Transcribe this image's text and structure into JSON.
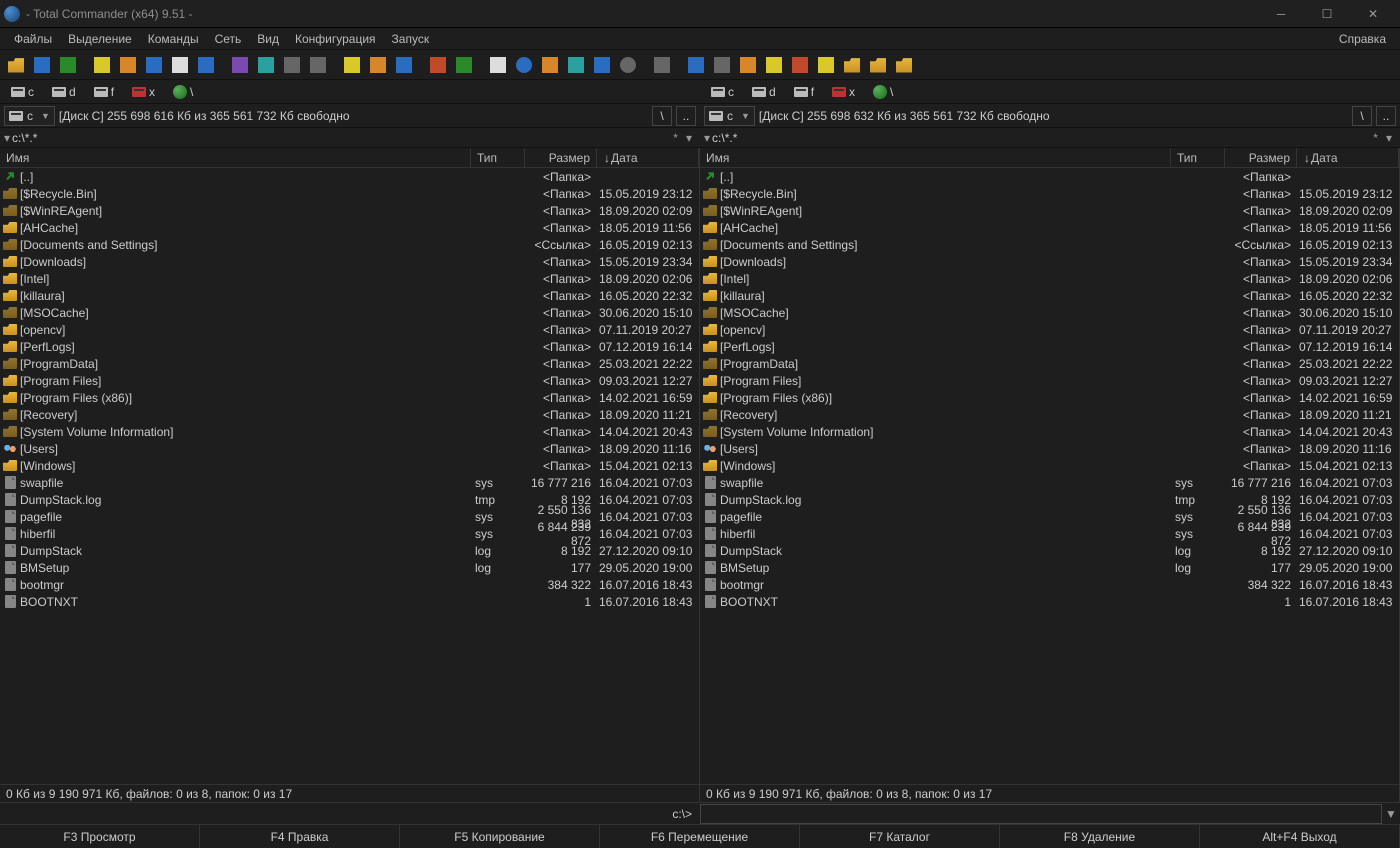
{
  "window": {
    "title": " - Total Commander (x64) 9.51 - "
  },
  "menu": {
    "items": [
      "Файлы",
      "Выделение",
      "Команды",
      "Сеть",
      "Вид",
      "Конфигурация",
      "Запуск"
    ],
    "right": "Справка"
  },
  "toolbar": {
    "buttons": [
      {
        "name": "open-icon",
        "cls": "ic-open"
      },
      {
        "name": "split-icon",
        "cls": "ic-blue"
      },
      {
        "name": "refresh-icon",
        "cls": "ic-green"
      },
      {
        "name": "sep"
      },
      {
        "name": "windows-icon",
        "cls": "ic-yellow"
      },
      {
        "name": "desktop-icon",
        "cls": "ic-orange"
      },
      {
        "name": "screen-icon",
        "cls": "ic-blue"
      },
      {
        "name": "doc-icon",
        "cls": "ic-white"
      },
      {
        "name": "grid-icon",
        "cls": "ic-blue"
      },
      {
        "name": "sep"
      },
      {
        "name": "paint-icon",
        "cls": "ic-purple"
      },
      {
        "name": "tool-1-icon",
        "cls": "ic-teal"
      },
      {
        "name": "tool-2-icon",
        "cls": "ic-gray"
      },
      {
        "name": "cmd-icon",
        "cls": "ic-gray"
      },
      {
        "name": "sep"
      },
      {
        "name": "gear-icon",
        "cls": "ic-yellow"
      },
      {
        "name": "box-icon",
        "cls": "ic-orange"
      },
      {
        "name": "people-icon",
        "cls": "ic-blue"
      },
      {
        "name": "sep"
      },
      {
        "name": "disk-icon",
        "cls": "ic-red"
      },
      {
        "name": "image-icon",
        "cls": "ic-green"
      },
      {
        "name": "sep"
      },
      {
        "name": "note-icon",
        "cls": "ic-white"
      },
      {
        "name": "go-icon",
        "cls": "ic-blue ic-circ"
      },
      {
        "name": "target-icon",
        "cls": "ic-orange"
      },
      {
        "name": "flag-icon",
        "cls": "ic-teal"
      },
      {
        "name": "window-icon",
        "cls": "ic-blue"
      },
      {
        "name": "cd-icon",
        "cls": "ic-gray ic-circ"
      },
      {
        "name": "sep"
      },
      {
        "name": "bug-icon",
        "cls": "ic-gray"
      },
      {
        "name": "sep"
      },
      {
        "name": "monitor-icon",
        "cls": "ic-blue"
      },
      {
        "name": "trash-icon",
        "cls": "ic-gray"
      },
      {
        "name": "pack-icon",
        "cls": "ic-orange"
      },
      {
        "name": "lock-icon",
        "cls": "ic-yellow"
      },
      {
        "name": "x-icon",
        "cls": "ic-red"
      },
      {
        "name": "star-icon",
        "cls": "ic-yellow"
      },
      {
        "name": "folder1-icon",
        "cls": "ic-open"
      },
      {
        "name": "folder2-icon",
        "cls": "ic-open"
      },
      {
        "name": "folder3-icon",
        "cls": "ic-open"
      }
    ]
  },
  "drives": {
    "items": [
      {
        "label": "c",
        "type": "hdd"
      },
      {
        "label": "d",
        "type": "hdd"
      },
      {
        "label": "f",
        "type": "hdd"
      },
      {
        "label": "x",
        "type": "net"
      },
      {
        "label": "\\",
        "type": "globe"
      }
    ]
  },
  "left": {
    "drive_label": "c",
    "disk_info": "[Диск C]  255 698 616 Кб из 365 561 732 Кб свободно",
    "nav_buttons": {
      "back": "\\",
      "up": ".."
    },
    "path": "c:\\*.*",
    "header": {
      "name": "Имя",
      "ext": "Тип",
      "size": "Размер",
      "date": "Дата",
      "sort_indicator": "↓"
    },
    "files": [
      {
        "icon": "up",
        "name": "[..]",
        "ext": "",
        "size": "<Папка>",
        "date": ""
      },
      {
        "icon": "folder",
        "hidden": true,
        "name": "[$Recycle.Bin]",
        "ext": "",
        "size": "<Папка>",
        "date": "15.05.2019 23:12"
      },
      {
        "icon": "folder",
        "hidden": true,
        "name": "[$WinREAgent]",
        "ext": "",
        "size": "<Папка>",
        "date": "18.09.2020 02:09"
      },
      {
        "icon": "folder",
        "name": "[AHCache]",
        "ext": "",
        "size": "<Папка>",
        "date": "18.05.2019 11:56"
      },
      {
        "icon": "folder",
        "hidden": true,
        "name": "[Documents and Settings]",
        "ext": "",
        "size": "<Ссылка>",
        "date": "16.05.2019 02:13"
      },
      {
        "icon": "folder",
        "name": "[Downloads]",
        "ext": "",
        "size": "<Папка>",
        "date": "15.05.2019 23:34"
      },
      {
        "icon": "folder",
        "name": "[Intel]",
        "ext": "",
        "size": "<Папка>",
        "date": "18.09.2020 02:06"
      },
      {
        "icon": "folder",
        "name": "[killaura]",
        "ext": "",
        "size": "<Папка>",
        "date": "16.05.2020 22:32"
      },
      {
        "icon": "folder",
        "hidden": true,
        "name": "[MSOCache]",
        "ext": "",
        "size": "<Папка>",
        "date": "30.06.2020 15:10"
      },
      {
        "icon": "folder",
        "name": "[opencv]",
        "ext": "",
        "size": "<Папка>",
        "date": "07.11.2019 20:27"
      },
      {
        "icon": "folder",
        "name": "[PerfLogs]",
        "ext": "",
        "size": "<Папка>",
        "date": "07.12.2019 16:14"
      },
      {
        "icon": "folder",
        "hidden": true,
        "name": "[ProgramData]",
        "ext": "",
        "size": "<Папка>",
        "date": "25.03.2021 22:22"
      },
      {
        "icon": "folder",
        "name": "[Program Files]",
        "ext": "",
        "size": "<Папка>",
        "date": "09.03.2021 12:27"
      },
      {
        "icon": "folder",
        "name": "[Program Files (x86)]",
        "ext": "",
        "size": "<Папка>",
        "date": "14.02.2021 16:59"
      },
      {
        "icon": "folder",
        "hidden": true,
        "name": "[Recovery]",
        "ext": "",
        "size": "<Папка>",
        "date": "18.09.2020 11:21"
      },
      {
        "icon": "folder",
        "hidden": true,
        "name": "[System Volume Information]",
        "ext": "",
        "size": "<Папка>",
        "date": "14.04.2021 20:43"
      },
      {
        "icon": "users",
        "name": "[Users]",
        "ext": "",
        "size": "<Папка>",
        "date": "18.09.2020 11:16"
      },
      {
        "icon": "folder",
        "name": "[Windows]",
        "ext": "",
        "size": "<Папка>",
        "date": "15.04.2021 02:13"
      },
      {
        "icon": "file",
        "hidden": true,
        "name": "swapfile",
        "ext": "sys",
        "size": "16 777 216",
        "date": "16.04.2021 07:03"
      },
      {
        "icon": "file",
        "hidden": true,
        "name": "DumpStack.log",
        "ext": "tmp",
        "size": "8 192",
        "date": "16.04.2021 07:03"
      },
      {
        "icon": "file",
        "hidden": true,
        "name": "pagefile",
        "ext": "sys",
        "size": "2 550 136 832",
        "date": "16.04.2021 07:03"
      },
      {
        "icon": "file",
        "hidden": true,
        "name": "hiberfil",
        "ext": "sys",
        "size": "6 844 239 872",
        "date": "16.04.2021 07:03"
      },
      {
        "icon": "file",
        "hidden": true,
        "name": "DumpStack",
        "ext": "log",
        "size": "8 192",
        "date": "27.12.2020 09:10"
      },
      {
        "icon": "file",
        "hidden": true,
        "name": "BMSetup",
        "ext": "log",
        "size": "177",
        "date": "29.05.2020 19:00"
      },
      {
        "icon": "file",
        "hidden": true,
        "name": "bootmgr",
        "ext": "",
        "size": "384 322",
        "date": "16.07.2016 18:43"
      },
      {
        "icon": "file",
        "hidden": true,
        "name": "BOOTNXT",
        "ext": "",
        "size": "1",
        "date": "16.07.2016 18:43"
      }
    ],
    "status": "0 Кб из 9 190 971 Кб, файлов: 0 из 8, папок: 0 из 17"
  },
  "right": {
    "drive_label": "c",
    "disk_info": "[Диск C]  255 698 632 Кб из 365 561 732 Кб свободно",
    "nav_buttons": {
      "back": "\\",
      "up": ".."
    },
    "path": "c:\\*.*",
    "header": {
      "name": "Имя",
      "ext": "Тип",
      "size": "Размер",
      "date": "Дата",
      "sort_indicator": "↓"
    },
    "files": [
      {
        "icon": "up",
        "name": "[..]",
        "ext": "",
        "size": "<Папка>",
        "date": ""
      },
      {
        "icon": "folder",
        "hidden": true,
        "name": "[$Recycle.Bin]",
        "ext": "",
        "size": "<Папка>",
        "date": "15.05.2019 23:12"
      },
      {
        "icon": "folder",
        "hidden": true,
        "name": "[$WinREAgent]",
        "ext": "",
        "size": "<Папка>",
        "date": "18.09.2020 02:09"
      },
      {
        "icon": "folder",
        "name": "[AHCache]",
        "ext": "",
        "size": "<Папка>",
        "date": "18.05.2019 11:56"
      },
      {
        "icon": "folder",
        "hidden": true,
        "name": "[Documents and Settings]",
        "ext": "",
        "size": "<Ссылка>",
        "date": "16.05.2019 02:13"
      },
      {
        "icon": "folder",
        "name": "[Downloads]",
        "ext": "",
        "size": "<Папка>",
        "date": "15.05.2019 23:34"
      },
      {
        "icon": "folder",
        "name": "[Intel]",
        "ext": "",
        "size": "<Папка>",
        "date": "18.09.2020 02:06"
      },
      {
        "icon": "folder",
        "name": "[killaura]",
        "ext": "",
        "size": "<Папка>",
        "date": "16.05.2020 22:32"
      },
      {
        "icon": "folder",
        "hidden": true,
        "name": "[MSOCache]",
        "ext": "",
        "size": "<Папка>",
        "date": "30.06.2020 15:10"
      },
      {
        "icon": "folder",
        "name": "[opencv]",
        "ext": "",
        "size": "<Папка>",
        "date": "07.11.2019 20:27"
      },
      {
        "icon": "folder",
        "name": "[PerfLogs]",
        "ext": "",
        "size": "<Папка>",
        "date": "07.12.2019 16:14"
      },
      {
        "icon": "folder",
        "hidden": true,
        "name": "[ProgramData]",
        "ext": "",
        "size": "<Папка>",
        "date": "25.03.2021 22:22"
      },
      {
        "icon": "folder",
        "name": "[Program Files]",
        "ext": "",
        "size": "<Папка>",
        "date": "09.03.2021 12:27"
      },
      {
        "icon": "folder",
        "name": "[Program Files (x86)]",
        "ext": "",
        "size": "<Папка>",
        "date": "14.02.2021 16:59"
      },
      {
        "icon": "folder",
        "hidden": true,
        "name": "[Recovery]",
        "ext": "",
        "size": "<Папка>",
        "date": "18.09.2020 11:21"
      },
      {
        "icon": "folder",
        "hidden": true,
        "name": "[System Volume Information]",
        "ext": "",
        "size": "<Папка>",
        "date": "14.04.2021 20:43"
      },
      {
        "icon": "users",
        "name": "[Users]",
        "ext": "",
        "size": "<Папка>",
        "date": "18.09.2020 11:16"
      },
      {
        "icon": "folder",
        "name": "[Windows]",
        "ext": "",
        "size": "<Папка>",
        "date": "15.04.2021 02:13"
      },
      {
        "icon": "file",
        "hidden": true,
        "name": "swapfile",
        "ext": "sys",
        "size": "16 777 216",
        "date": "16.04.2021 07:03"
      },
      {
        "icon": "file",
        "hidden": true,
        "name": "DumpStack.log",
        "ext": "tmp",
        "size": "8 192",
        "date": "16.04.2021 07:03"
      },
      {
        "icon": "file",
        "hidden": true,
        "name": "pagefile",
        "ext": "sys",
        "size": "2 550 136 832",
        "date": "16.04.2021 07:03"
      },
      {
        "icon": "file",
        "hidden": true,
        "name": "hiberfil",
        "ext": "sys",
        "size": "6 844 239 872",
        "date": "16.04.2021 07:03"
      },
      {
        "icon": "file",
        "hidden": true,
        "name": "DumpStack",
        "ext": "log",
        "size": "8 192",
        "date": "27.12.2020 09:10"
      },
      {
        "icon": "file",
        "hidden": true,
        "name": "BMSetup",
        "ext": "log",
        "size": "177",
        "date": "29.05.2020 19:00"
      },
      {
        "icon": "file",
        "hidden": true,
        "name": "bootmgr",
        "ext": "",
        "size": "384 322",
        "date": "16.07.2016 18:43"
      },
      {
        "icon": "file",
        "hidden": true,
        "name": "BOOTNXT",
        "ext": "",
        "size": "1",
        "date": "16.07.2016 18:43"
      }
    ],
    "status": "0 Кб из 9 190 971 Кб, файлов: 0 из 8, папок: 0 из 17"
  },
  "cmdline": {
    "prompt": "c:\\>",
    "value": ""
  },
  "fkeys": [
    "F3 Просмотр",
    "F4 Правка",
    "F5 Копирование",
    "F6 Перемещение",
    "F7 Каталог",
    "F8 Удаление",
    "Alt+F4 Выход"
  ]
}
